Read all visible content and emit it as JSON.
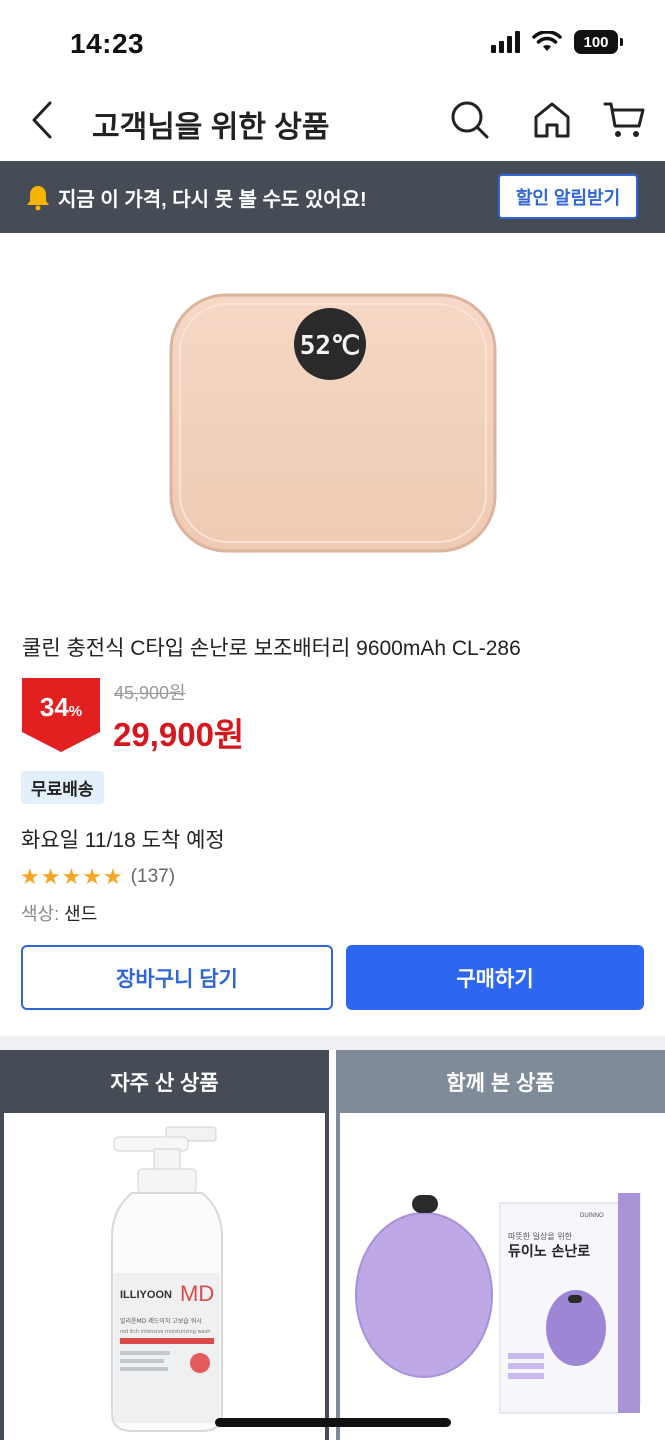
{
  "status": {
    "time": "14:23",
    "battery": "100"
  },
  "nav": {
    "title": "고객님을 위한 상품",
    "icons": [
      "chevron-left-icon",
      "search-icon",
      "home-icon",
      "cart-icon"
    ]
  },
  "banner": {
    "text": "지금 이 가격, 다시 못 볼 수도 있어요!",
    "button_label": "할인 알림받기",
    "icon": "bell-icon"
  },
  "product": {
    "display_temp": "52℃",
    "title": "쿨린 충전식 C타입 손난로 보조배터리 9600mAh CL-286",
    "discount_value": "34",
    "discount_unit": "%",
    "original_price": "45,900원",
    "sale_price": "29,900원",
    "shipping_badge": "무료배송",
    "delivery_text": "화요일 11/18 도착 예정",
    "rating_stars": 5,
    "review_count": "(137)",
    "color_label": "색상:",
    "color_value": "샌드"
  },
  "actions": {
    "cart_label": "장바구니 담기",
    "buy_label": "구매하기"
  },
  "recommendations": {
    "left": {
      "header": "자주 산 상품",
      "product_brand": "ILLIYOON",
      "product_badge": "MD",
      "product_line1": "일리윤MD 레드이치 고보습 워시",
      "product_line2": "red itch intensive moisturizing wash"
    },
    "right": {
      "header": "함께 본 상품",
      "box_tagline": "따뜻한 일상을 위한",
      "box_title": "듀이노 손난로",
      "box_brand": "DUINNO"
    }
  },
  "colors": {
    "accent_blue": "#2d67f0",
    "sale_red": "#d6171e",
    "banner_dark": "#454c56",
    "header_gray": "#7f8b99",
    "star": "#f5a623"
  }
}
